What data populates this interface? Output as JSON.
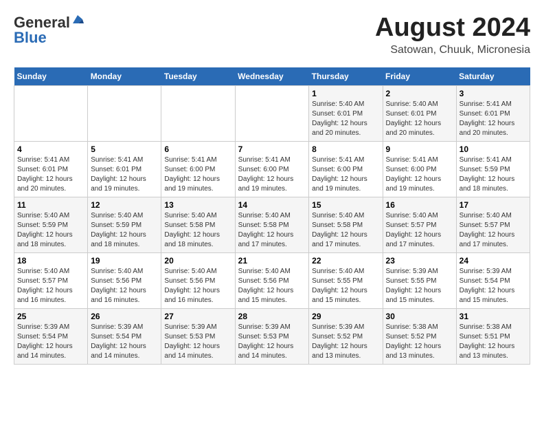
{
  "header": {
    "logo_line1": "General",
    "logo_line2": "Blue",
    "main_title": "August 2024",
    "subtitle": "Satowan, Chuuk, Micronesia"
  },
  "calendar": {
    "days_of_week": [
      "Sunday",
      "Monday",
      "Tuesday",
      "Wednesday",
      "Thursday",
      "Friday",
      "Saturday"
    ],
    "weeks": [
      [
        {
          "day": "",
          "info": ""
        },
        {
          "day": "",
          "info": ""
        },
        {
          "day": "",
          "info": ""
        },
        {
          "day": "",
          "info": ""
        },
        {
          "day": "1",
          "info": "Sunrise: 5:40 AM\nSunset: 6:01 PM\nDaylight: 12 hours and 20 minutes."
        },
        {
          "day": "2",
          "info": "Sunrise: 5:40 AM\nSunset: 6:01 PM\nDaylight: 12 hours and 20 minutes."
        },
        {
          "day": "3",
          "info": "Sunrise: 5:41 AM\nSunset: 6:01 PM\nDaylight: 12 hours and 20 minutes."
        }
      ],
      [
        {
          "day": "4",
          "info": "Sunrise: 5:41 AM\nSunset: 6:01 PM\nDaylight: 12 hours and 20 minutes."
        },
        {
          "day": "5",
          "info": "Sunrise: 5:41 AM\nSunset: 6:01 PM\nDaylight: 12 hours and 19 minutes."
        },
        {
          "day": "6",
          "info": "Sunrise: 5:41 AM\nSunset: 6:00 PM\nDaylight: 12 hours and 19 minutes."
        },
        {
          "day": "7",
          "info": "Sunrise: 5:41 AM\nSunset: 6:00 PM\nDaylight: 12 hours and 19 minutes."
        },
        {
          "day": "8",
          "info": "Sunrise: 5:41 AM\nSunset: 6:00 PM\nDaylight: 12 hours and 19 minutes."
        },
        {
          "day": "9",
          "info": "Sunrise: 5:41 AM\nSunset: 6:00 PM\nDaylight: 12 hours and 19 minutes."
        },
        {
          "day": "10",
          "info": "Sunrise: 5:41 AM\nSunset: 5:59 PM\nDaylight: 12 hours and 18 minutes."
        }
      ],
      [
        {
          "day": "11",
          "info": "Sunrise: 5:40 AM\nSunset: 5:59 PM\nDaylight: 12 hours and 18 minutes."
        },
        {
          "day": "12",
          "info": "Sunrise: 5:40 AM\nSunset: 5:59 PM\nDaylight: 12 hours and 18 minutes."
        },
        {
          "day": "13",
          "info": "Sunrise: 5:40 AM\nSunset: 5:58 PM\nDaylight: 12 hours and 18 minutes."
        },
        {
          "day": "14",
          "info": "Sunrise: 5:40 AM\nSunset: 5:58 PM\nDaylight: 12 hours and 17 minutes."
        },
        {
          "day": "15",
          "info": "Sunrise: 5:40 AM\nSunset: 5:58 PM\nDaylight: 12 hours and 17 minutes."
        },
        {
          "day": "16",
          "info": "Sunrise: 5:40 AM\nSunset: 5:57 PM\nDaylight: 12 hours and 17 minutes."
        },
        {
          "day": "17",
          "info": "Sunrise: 5:40 AM\nSunset: 5:57 PM\nDaylight: 12 hours and 17 minutes."
        }
      ],
      [
        {
          "day": "18",
          "info": "Sunrise: 5:40 AM\nSunset: 5:57 PM\nDaylight: 12 hours and 16 minutes."
        },
        {
          "day": "19",
          "info": "Sunrise: 5:40 AM\nSunset: 5:56 PM\nDaylight: 12 hours and 16 minutes."
        },
        {
          "day": "20",
          "info": "Sunrise: 5:40 AM\nSunset: 5:56 PM\nDaylight: 12 hours and 16 minutes."
        },
        {
          "day": "21",
          "info": "Sunrise: 5:40 AM\nSunset: 5:56 PM\nDaylight: 12 hours and 15 minutes."
        },
        {
          "day": "22",
          "info": "Sunrise: 5:40 AM\nSunset: 5:55 PM\nDaylight: 12 hours and 15 minutes."
        },
        {
          "day": "23",
          "info": "Sunrise: 5:39 AM\nSunset: 5:55 PM\nDaylight: 12 hours and 15 minutes."
        },
        {
          "day": "24",
          "info": "Sunrise: 5:39 AM\nSunset: 5:54 PM\nDaylight: 12 hours and 15 minutes."
        }
      ],
      [
        {
          "day": "25",
          "info": "Sunrise: 5:39 AM\nSunset: 5:54 PM\nDaylight: 12 hours and 14 minutes."
        },
        {
          "day": "26",
          "info": "Sunrise: 5:39 AM\nSunset: 5:54 PM\nDaylight: 12 hours and 14 minutes."
        },
        {
          "day": "27",
          "info": "Sunrise: 5:39 AM\nSunset: 5:53 PM\nDaylight: 12 hours and 14 minutes."
        },
        {
          "day": "28",
          "info": "Sunrise: 5:39 AM\nSunset: 5:53 PM\nDaylight: 12 hours and 14 minutes."
        },
        {
          "day": "29",
          "info": "Sunrise: 5:39 AM\nSunset: 5:52 PM\nDaylight: 12 hours and 13 minutes."
        },
        {
          "day": "30",
          "info": "Sunrise: 5:38 AM\nSunset: 5:52 PM\nDaylight: 12 hours and 13 minutes."
        },
        {
          "day": "31",
          "info": "Sunrise: 5:38 AM\nSunset: 5:51 PM\nDaylight: 12 hours and 13 minutes."
        }
      ]
    ]
  }
}
